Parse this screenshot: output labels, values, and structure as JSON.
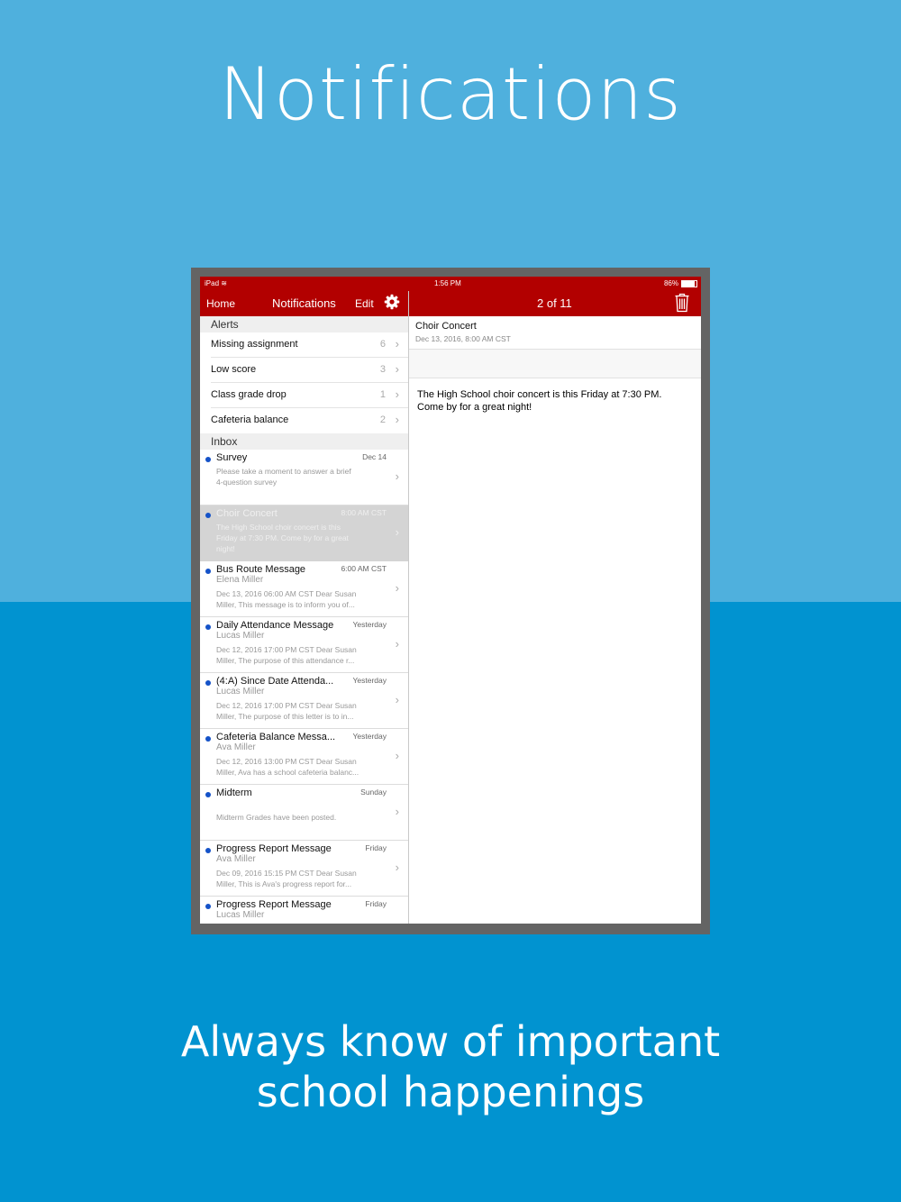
{
  "colors": {
    "bg_top": "#4FB0DD",
    "bg_bottom": "#0193D0",
    "bezel": "#646464",
    "app_red": "#B20000",
    "unread_dot": "#1452C8"
  },
  "headline": "Notifications",
  "caption": {
    "line1": "Always know of important",
    "line2": "school happenings"
  },
  "status_bar": {
    "device": "iPad",
    "time": "1:56 PM",
    "battery": "86%",
    "battery_level": 0.86
  },
  "nav": {
    "home_label": "Home",
    "title": "Notifications",
    "edit_label": "Edit",
    "settings_icon": "gear-icon",
    "message_position": "2 of 11",
    "delete_icon": "trash-icon"
  },
  "alerts": {
    "header": "Alerts",
    "items": [
      {
        "label": "Missing assignment",
        "count": "6"
      },
      {
        "label": "Low score",
        "count": "3"
      },
      {
        "label": "Class grade drop",
        "count": "1"
      },
      {
        "label": "Cafeteria balance",
        "count": "2"
      }
    ]
  },
  "inbox": {
    "header": "Inbox",
    "items": [
      {
        "subject": "Survey",
        "date": "Dec 14",
        "sender": "",
        "preview1": "Please take a moment to answer a brief",
        "preview2": "4-question survey",
        "preview3": ""
      },
      {
        "subject": "Choir Concert",
        "date": "8:00 AM CST",
        "sender": "",
        "preview1": "The High School choir concert is this",
        "preview2": "Friday at 7:30 PM. Come by for a great",
        "preview3": "night!"
      },
      {
        "subject": "Bus Route Message",
        "date": "6:00 AM CST",
        "sender": "Elena Miller",
        "preview1": "Dec 13, 2016 06:00 AM CST  Dear Susan",
        "preview2": "Miller,  This message is to inform you of...",
        "preview3": ""
      },
      {
        "subject": "Daily Attendance Message",
        "date": "Yesterday",
        "sender": "Lucas Miller",
        "preview1": "Dec 12, 2016 17:00 PM CST Dear Susan",
        "preview2": "Miller, The purpose of this attendance r...",
        "preview3": ""
      },
      {
        "subject": "(4:A) Since Date Attenda...",
        "date": "Yesterday",
        "sender": "Lucas Miller",
        "preview1": "Dec 12, 2016 17:00 PM CST  Dear Susan",
        "preview2": "Miller,  The purpose of this letter is to in...",
        "preview3": ""
      },
      {
        "subject": "Cafeteria Balance Messa...",
        "date": "Yesterday",
        "sender": "Ava Miller",
        "preview1": "Dec 12, 2016 13:00 PM CST Dear Susan",
        "preview2": "Miller, Ava has a school cafeteria balanc...",
        "preview3": ""
      },
      {
        "subject": "Midterm",
        "date": "Sunday",
        "sender": "",
        "preview1": "",
        "preview2": "Midterm Grades have been posted.",
        "preview3": ""
      },
      {
        "subject": "Progress Report Message",
        "date": "Friday",
        "sender": "Ava Miller",
        "preview1": "Dec 09, 2016 15:15 PM CST  Dear Susan",
        "preview2": "Miller,  This is Ava's progress report for...",
        "preview3": ""
      },
      {
        "subject": "Progress Report Message",
        "date": "Friday",
        "sender": "Lucas Miller",
        "preview1": "",
        "preview2": "",
        "preview3": ""
      }
    ]
  },
  "detail": {
    "title": "Choir Concert",
    "date": "Dec 13, 2016, 8:00 AM CST",
    "body_line1": "The High School choir concert is this Friday at 7:30 PM.",
    "body_line2": "Come by for a great night!"
  }
}
